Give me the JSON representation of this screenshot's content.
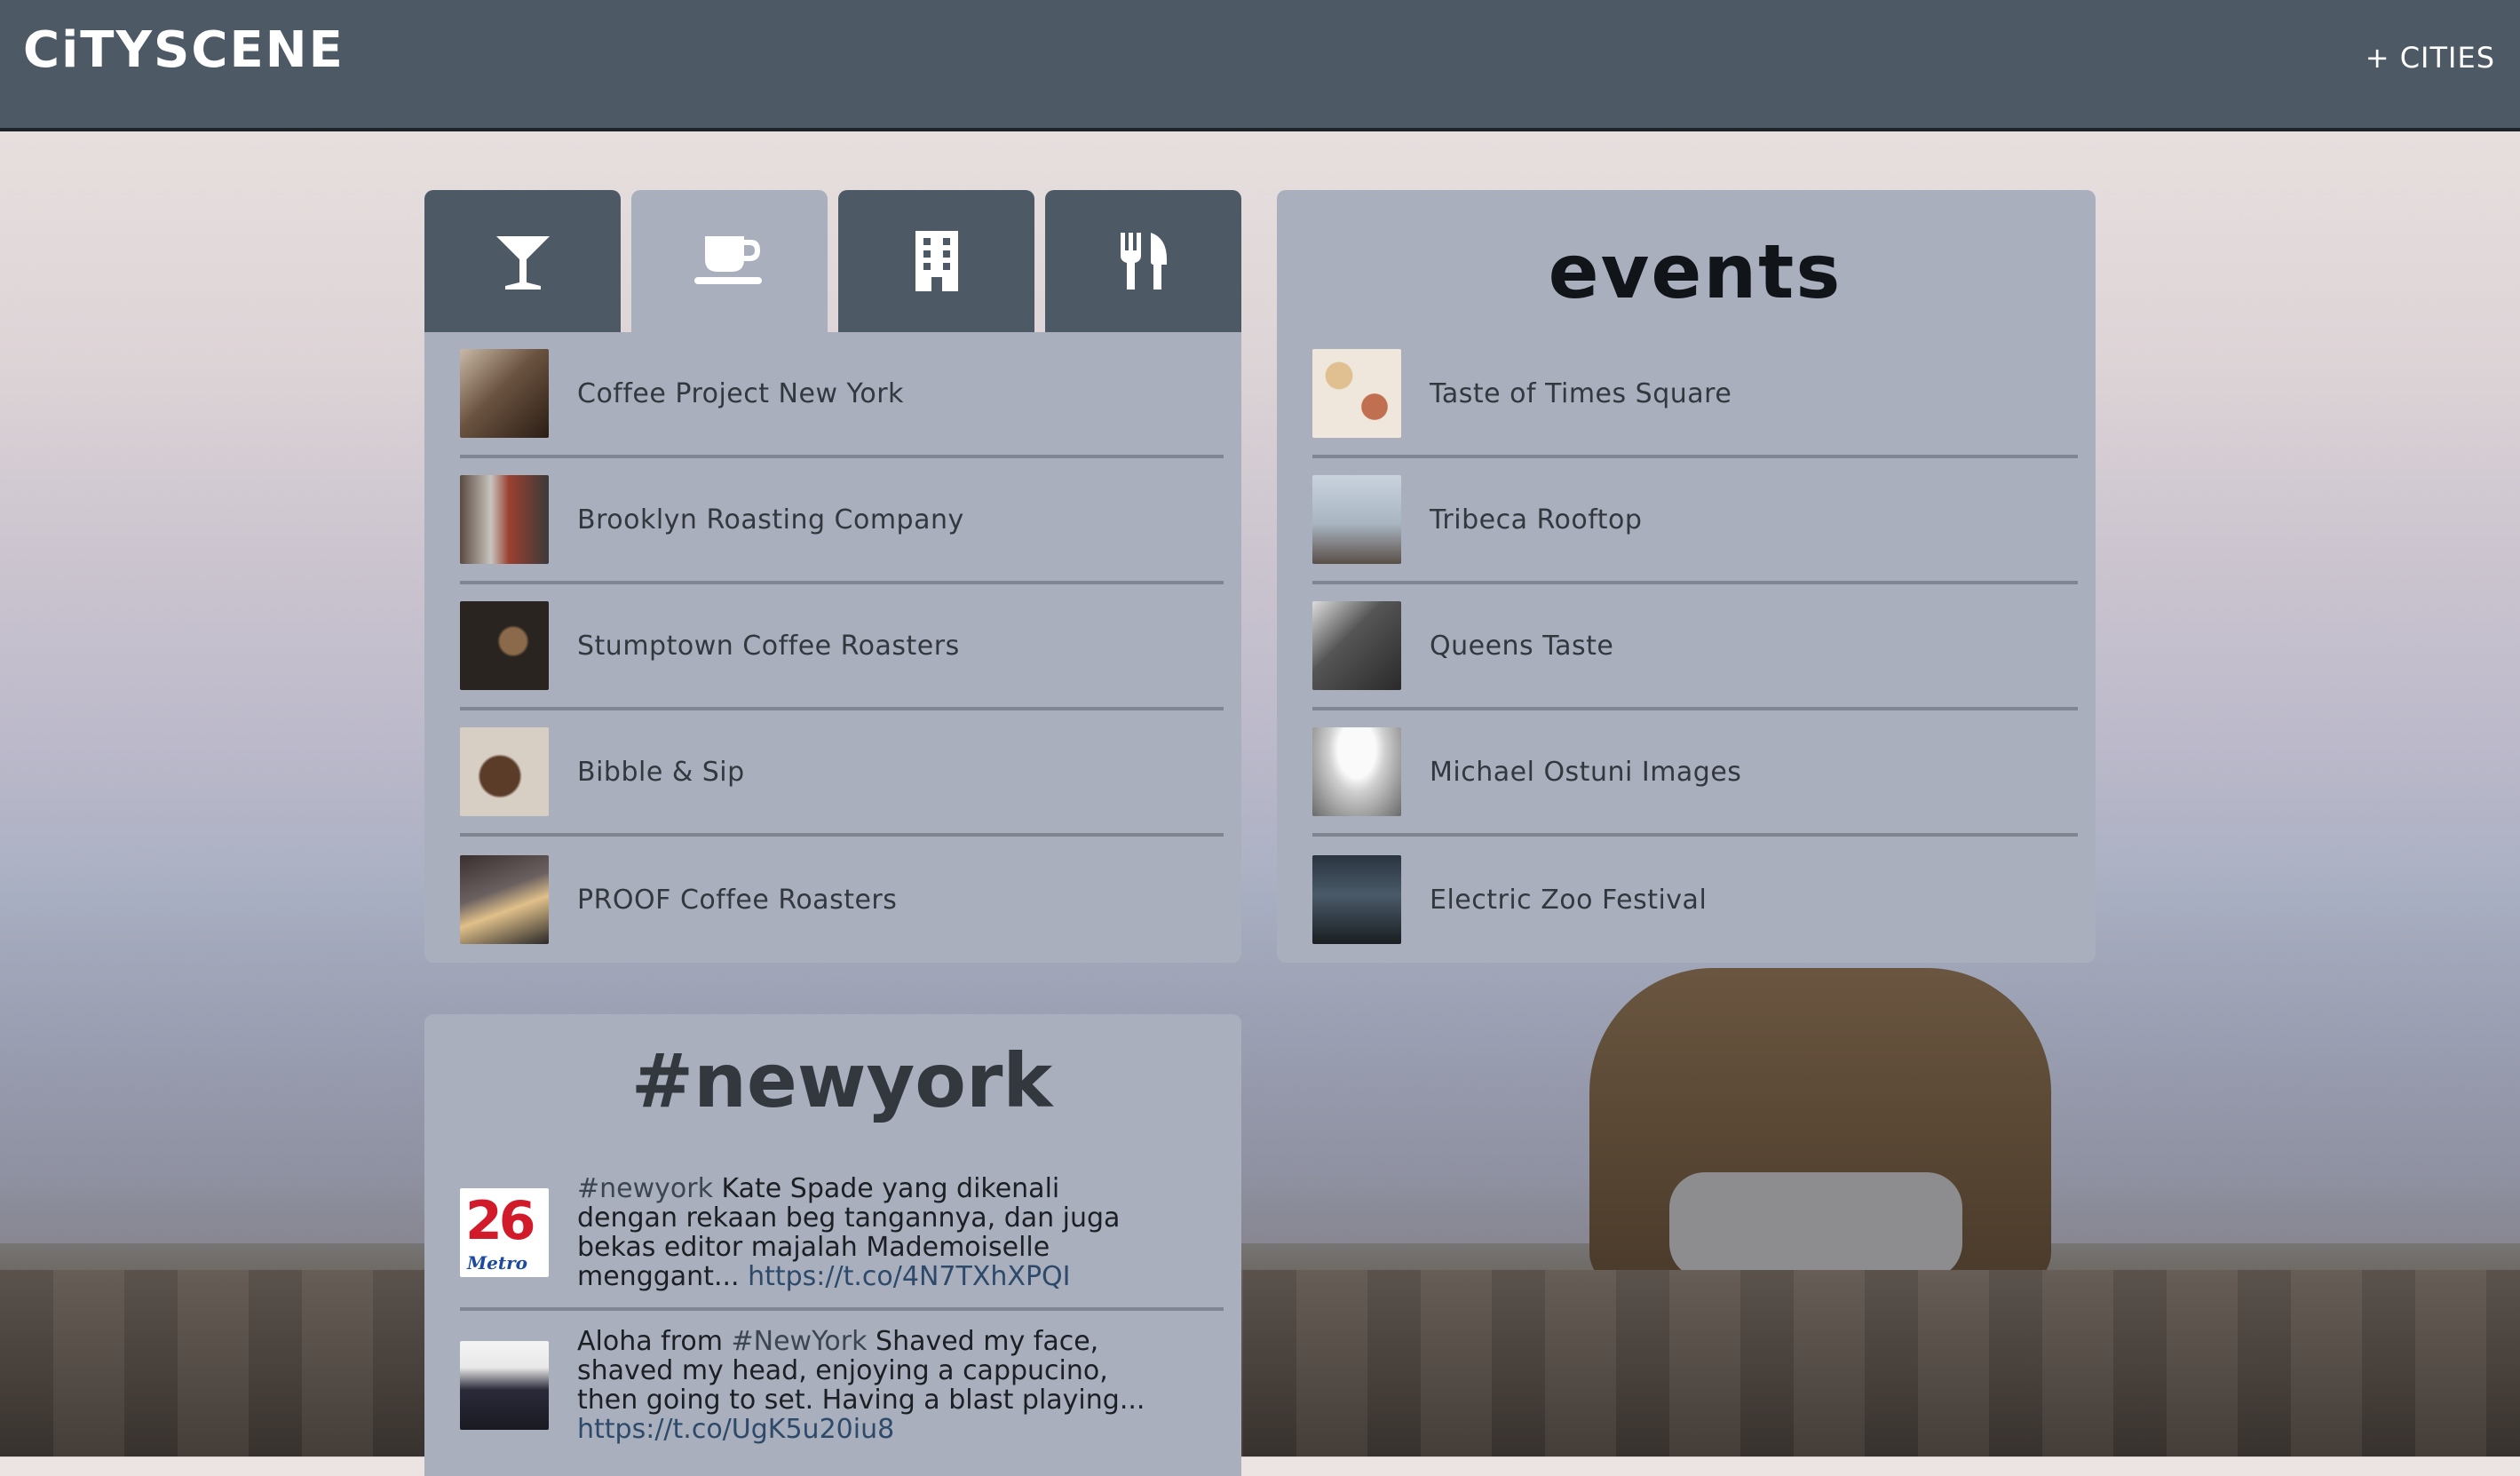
{
  "header": {
    "brand": "CiTYSCENE",
    "cities_link": "+ CITIES"
  },
  "tabs": [
    {
      "icon": "cocktail-icon",
      "active": false
    },
    {
      "icon": "coffee-cup-icon",
      "active": true
    },
    {
      "icon": "building-icon",
      "active": false
    },
    {
      "icon": "fork-knife-icon",
      "active": false
    }
  ],
  "places": [
    {
      "name": "Coffee Project New York"
    },
    {
      "name": "Brooklyn Roasting Company"
    },
    {
      "name": "Stumptown Coffee Roasters"
    },
    {
      "name": "Bibble & Sip"
    },
    {
      "name": "PROOF Coffee Roasters"
    }
  ],
  "events": {
    "title": "events",
    "items": [
      {
        "name": "Taste of Times Square"
      },
      {
        "name": "Tribeca Rooftop"
      },
      {
        "name": "Queens Taste"
      },
      {
        "name": "Michael Ostuni Images"
      },
      {
        "name": "Electric Zoo Festival"
      }
    ]
  },
  "tweets": {
    "title": "#newyork",
    "items": [
      {
        "avatar_text": "26",
        "avatar_caption": "Metro",
        "hashtag": "#newyork",
        "pre": "",
        "body": " Kate Spade yang dikenali dengan rekaan beg tangannya, dan juga bekas editor majalah Mademoiselle menggant... ",
        "link": "https://t.co/4N7TXhXPQI"
      },
      {
        "pre": "Aloha from ",
        "hashtag": "#NewYork",
        "body": " Shaved my face, shaved my head, enjoying a cappucino, then going to set. Having a blast playing... ",
        "link": "https://t.co/UgK5u20iu8"
      }
    ]
  },
  "colors": {
    "topbar": "#4d5a66",
    "panel": "#a9afbd",
    "tab_inactive": "#4d5a66"
  }
}
